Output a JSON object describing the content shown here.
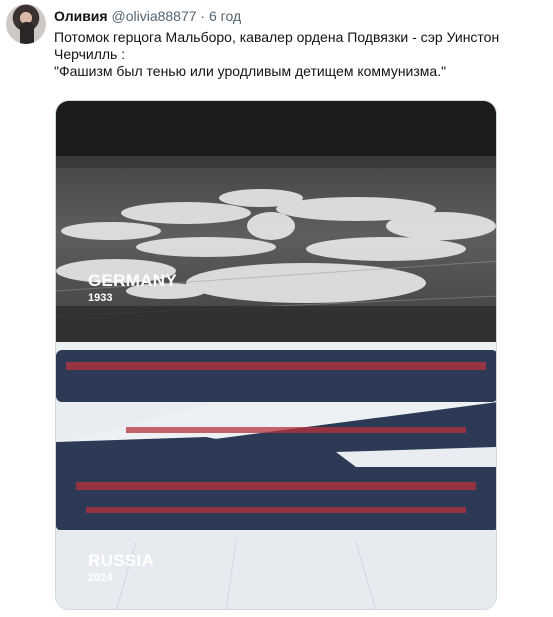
{
  "tweet": {
    "author_name": "Оливия",
    "author_handle": "@olivia88877",
    "separator": "·",
    "time": "6 год",
    "text_lines": [
      "Потомок герцога Мальборо, кавалер ордена Подвязки - сэр Уинстон",
      "Черчилль :",
      "\"Фашизм был тенью или уродливым детищем коммунизма.\""
    ]
  },
  "media": {
    "top_caption": {
      "country": "GERMANY",
      "year": "1933"
    },
    "bottom_caption": {
      "country": "RUSSIA",
      "year": "2024"
    }
  }
}
